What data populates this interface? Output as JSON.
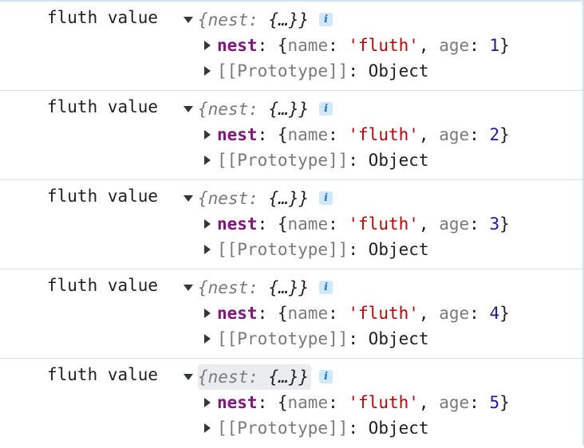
{
  "console": {
    "entries": [
      {
        "message": "fluth value",
        "summary_key": "nest",
        "summary_value": "{…}",
        "info_label": "i",
        "nest_key": "nest",
        "name_key": "name",
        "name_value": "'fluth'",
        "age_key": "age",
        "age_value": "1",
        "proto_label": "[[Prototype]]",
        "proto_value": "Object"
      },
      {
        "message": "fluth value",
        "summary_key": "nest",
        "summary_value": "{…}",
        "info_label": "i",
        "nest_key": "nest",
        "name_key": "name",
        "name_value": "'fluth'",
        "age_key": "age",
        "age_value": "2",
        "proto_label": "[[Prototype]]",
        "proto_value": "Object"
      },
      {
        "message": "fluth value",
        "summary_key": "nest",
        "summary_value": "{…}",
        "info_label": "i",
        "nest_key": "nest",
        "name_key": "name",
        "name_value": "'fluth'",
        "age_key": "age",
        "age_value": "3",
        "proto_label": "[[Prototype]]",
        "proto_value": "Object"
      },
      {
        "message": "fluth value",
        "summary_key": "nest",
        "summary_value": "{…}",
        "info_label": "i",
        "nest_key": "nest",
        "name_key": "name",
        "name_value": "'fluth'",
        "age_key": "age",
        "age_value": "4",
        "proto_label": "[[Prototype]]",
        "proto_value": "Object"
      },
      {
        "message": "fluth value",
        "summary_key": "nest",
        "summary_value": "{…}",
        "info_label": "i",
        "nest_key": "nest",
        "name_key": "name",
        "name_value": "'fluth'",
        "age_key": "age",
        "age_value": "5",
        "proto_label": "[[Prototype]]",
        "proto_value": "Object"
      }
    ]
  },
  "colors": {
    "key": "#881280",
    "string": "#c80000",
    "number": "#1a1aa6",
    "separator": "#cfe3f6",
    "hover_highlight": "#eaecef"
  }
}
